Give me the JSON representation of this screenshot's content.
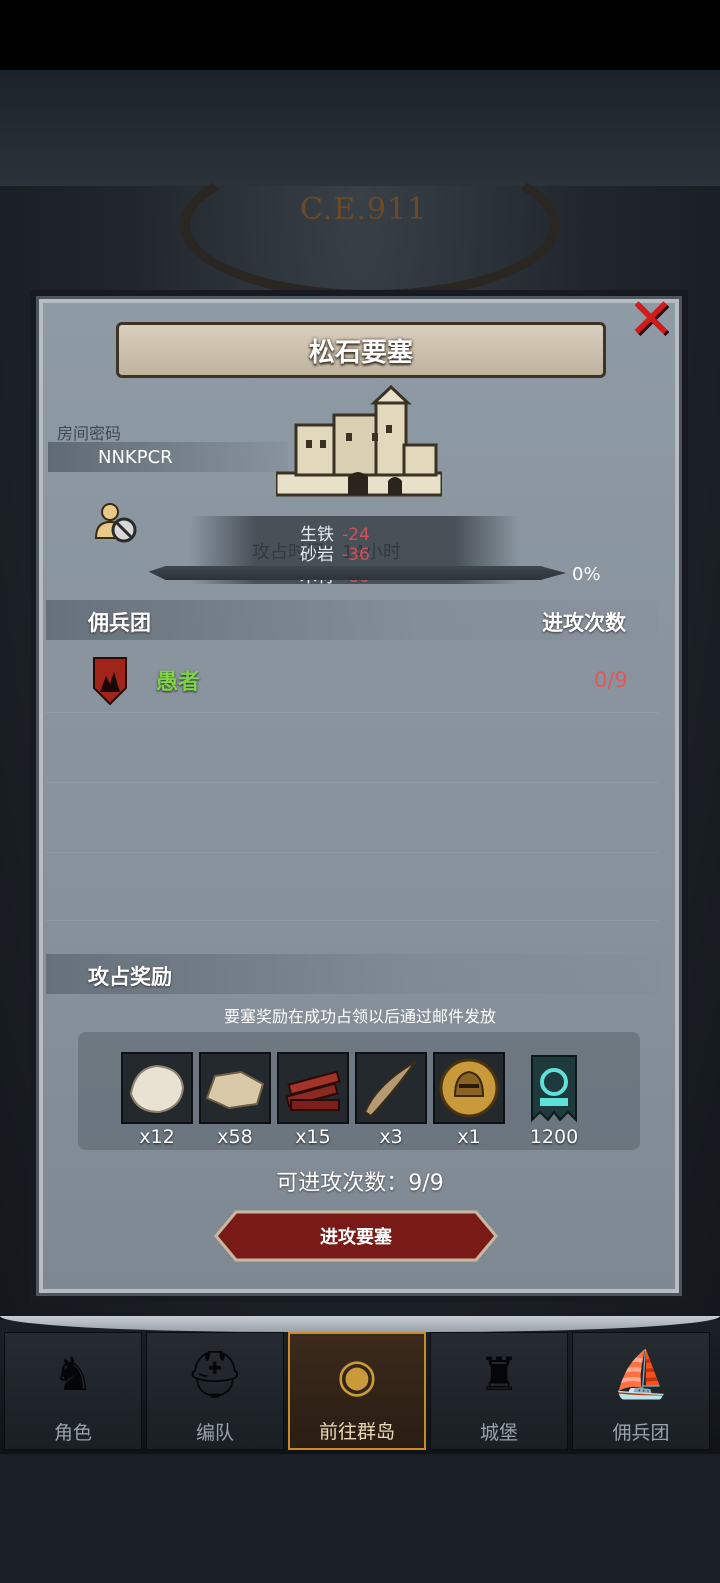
{
  "header": {
    "era": "C.E.911"
  },
  "dialog": {
    "title": "松石要塞",
    "room_label": "房间密码",
    "room_code": "NNKPCR",
    "attack_time_text": "攻占时间：14小时",
    "resources": [
      {
        "name": "生铁",
        "amount": "-24"
      },
      {
        "name": "砂岩",
        "amount": "-36"
      },
      {
        "name": "木材",
        "amount": "-60"
      }
    ],
    "progress": {
      "percent": 0,
      "label": "0%"
    },
    "guild_section": {
      "title": "佣兵团",
      "count_header": "进攻次数"
    },
    "guilds": [
      {
        "name": "愚者",
        "attacks": "0/9"
      }
    ],
    "rewards": {
      "title": "攻占奖励",
      "note": "要塞奖励在成功占领以后通过邮件发放",
      "items": [
        {
          "icon": "fur-pelt-icon",
          "qty": "x12"
        },
        {
          "icon": "leather-icon",
          "qty": "x58"
        },
        {
          "icon": "wood-planks-icon",
          "qty": "x15"
        },
        {
          "icon": "horn-icon",
          "qty": "x3"
        },
        {
          "icon": "knight-helmet-coin-icon",
          "qty": "x1"
        },
        {
          "icon": "guild-banner-icon",
          "qty": "1200"
        }
      ]
    },
    "attempts_text": "可进攻次数：9/9",
    "attack_button": "进攻要塞"
  },
  "nav": {
    "items": [
      {
        "label": "角色",
        "icon": "knight-icon"
      },
      {
        "label": "编队",
        "icon": "helmet-icon"
      },
      {
        "label": "前往群岛",
        "icon": "compass-icon",
        "active": true
      },
      {
        "label": "城堡",
        "icon": "castle-icon"
      },
      {
        "label": "佣兵团",
        "icon": "ship-icon"
      }
    ]
  },
  "colors": {
    "accent_red": "#d21b1b",
    "guild_green": "#7fd24a",
    "count_red": "#de5a5a",
    "gold": "#c88a2b"
  }
}
